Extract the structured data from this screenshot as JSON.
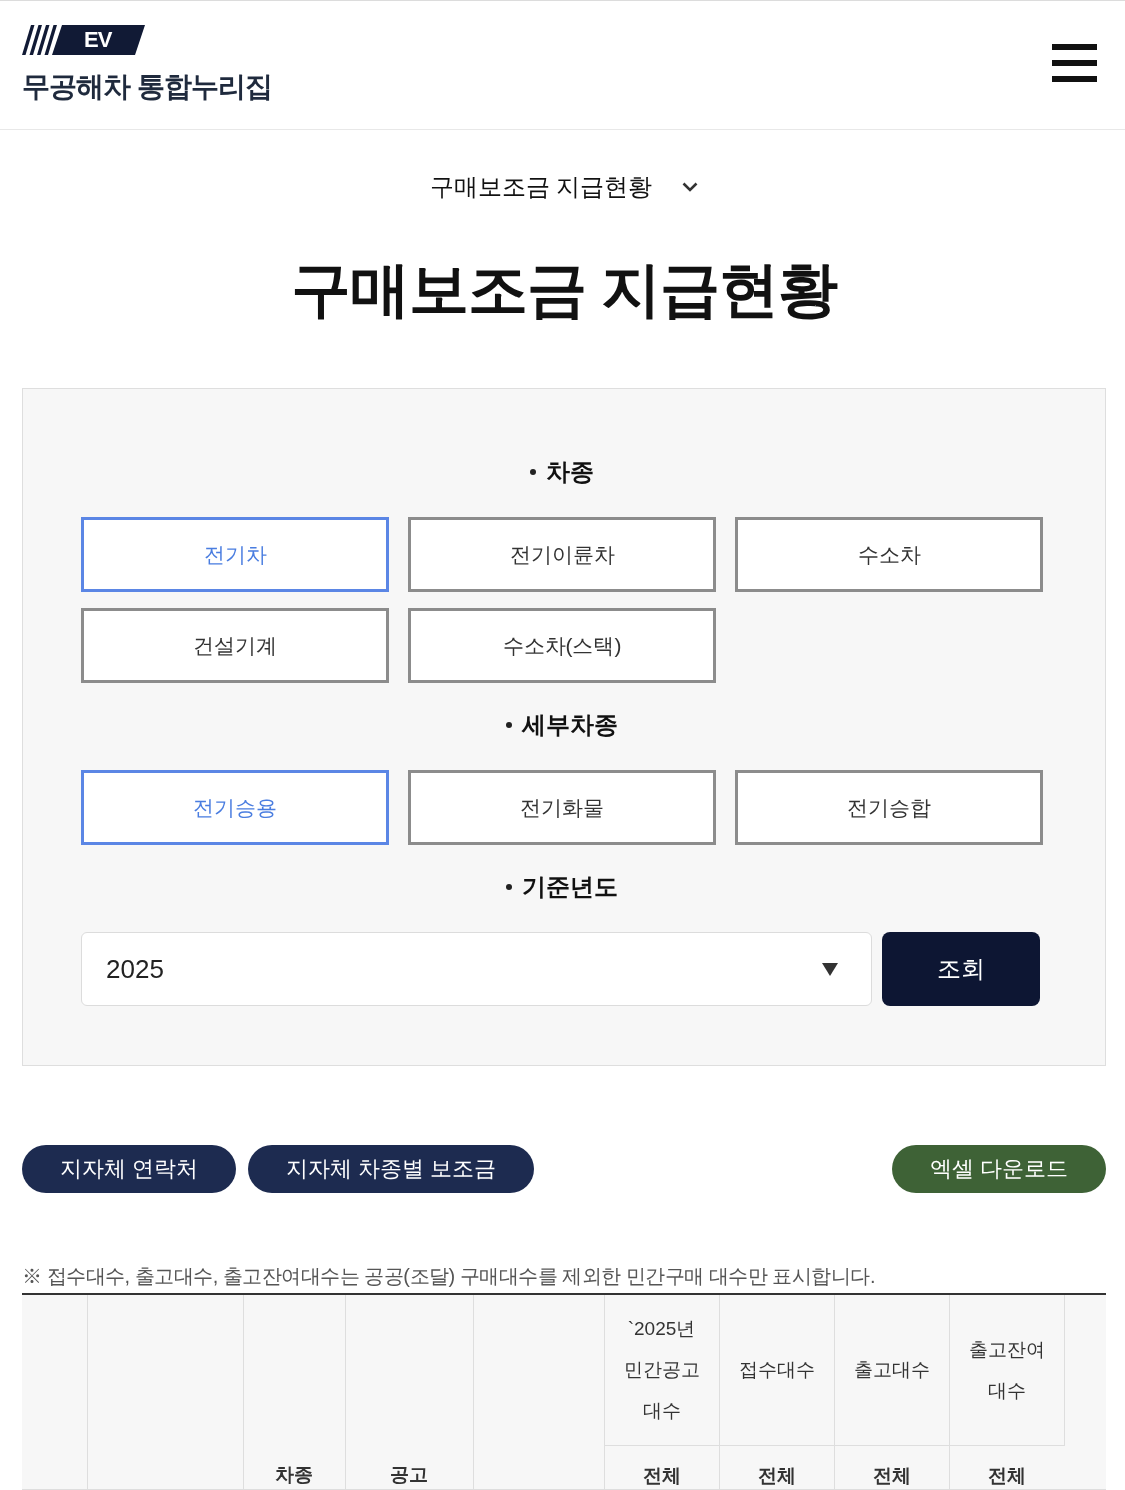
{
  "header": {
    "logo_badge": "EV",
    "site_title": "무공해차 통합누리집"
  },
  "nav_dropdown": {
    "label": "구매보조금 지급현황"
  },
  "page_title": "구매보조금 지급현황",
  "filters": [
    {
      "kind": "options",
      "label": "차종",
      "options": [
        {
          "label": "전기차",
          "selected": true
        },
        {
          "label": "전기이륜차",
          "selected": false
        },
        {
          "label": "수소차",
          "selected": false
        },
        {
          "label": "건설기계",
          "selected": false
        },
        {
          "label": "수소차(스택)",
          "selected": false
        }
      ]
    },
    {
      "kind": "options",
      "label": "세부차종",
      "options": [
        {
          "label": "전기승용",
          "selected": true
        },
        {
          "label": "전기화물",
          "selected": false
        },
        {
          "label": "전기승합",
          "selected": false
        }
      ]
    },
    {
      "kind": "select",
      "label": "기준년도",
      "value": "2025",
      "button": "조회"
    }
  ],
  "actions": [
    {
      "kind": "primary",
      "label": "지자체 연락처"
    },
    {
      "kind": "primary",
      "label": "지자체 차종별 보조금"
    },
    {
      "kind": "download",
      "label": "엑셀 다운로드"
    }
  ],
  "note": "※ 접수대수, 출고대수, 출고잔여대수는 공공(조달) 구매대수를 제외한 민간구매 대수만 표시합니다.",
  "table": {
    "columns": [
      {
        "kind": "blank"
      },
      {
        "kind": "blank"
      },
      {
        "kind": "tall",
        "label": "차종"
      },
      {
        "kind": "tall",
        "label": "공고"
      },
      {
        "kind": "blank"
      },
      {
        "kind": "split",
        "label": "`2025년 민간공고 대수",
        "sub_label": "전체"
      },
      {
        "kind": "split",
        "label": "접수대수",
        "sub_label": "전체"
      },
      {
        "kind": "split",
        "label": "출고대수",
        "sub_label": "전체"
      },
      {
        "kind": "split",
        "label": "출고잔여 대수",
        "sub_label": "전체"
      },
      {
        "kind": "blank"
      }
    ]
  }
}
